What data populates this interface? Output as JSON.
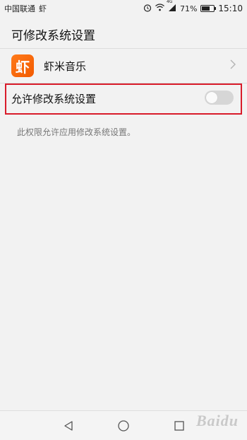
{
  "status_bar": {
    "carrier": "中国联通",
    "app_glyph": "虾",
    "alarm_icon": "alarm-icon",
    "wifi_icon": "wifi-icon",
    "network_type": "4G",
    "signal_icon": "signal-icon",
    "battery_percent": "71%",
    "battery_level": 0.71,
    "time": "15:10"
  },
  "page": {
    "title": "可修改系统设置"
  },
  "app": {
    "icon_glyph": "虾",
    "name": "虾米音乐",
    "chevron_icon": "chevron-right-icon"
  },
  "setting": {
    "label": "允许修改系统设置",
    "enabled": false
  },
  "description": "此权限允许应用修改系统设置。",
  "nav_bar": {
    "back_icon": "back-triangle-icon",
    "home_icon": "home-circle-icon",
    "recents_icon": "recents-square-icon"
  },
  "watermark": {
    "text": "Baidu"
  },
  "colors": {
    "background": "#f2f2f2",
    "highlight_border": "#d91c2b",
    "app_icon": "#f25a00",
    "toggle_off": "#d6d6d6"
  }
}
